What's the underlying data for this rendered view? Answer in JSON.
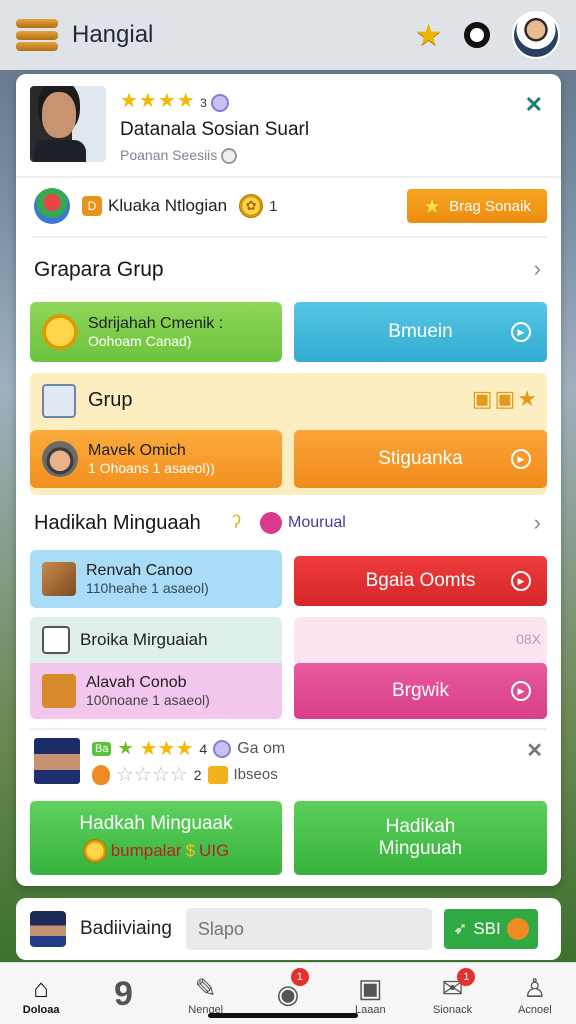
{
  "topbar": {
    "title": "Hangial"
  },
  "profile": {
    "stars": "★★★★",
    "star_count": "3",
    "name": "Datanala Sosian Suarl",
    "subtitle": "Poanan Seesiis"
  },
  "level": {
    "badge": "D",
    "label": "Kluaka Ntlogian",
    "coin_label": "1",
    "coin_icon": "✿",
    "button": "Brag Sonaik"
  },
  "section1": {
    "title": "Grapara Grup"
  },
  "tile_green": {
    "title": "Sdrijahah Cmenik :",
    "subtitle": "Oohoam Canad)"
  },
  "btn_blue": {
    "label": "Bmuein"
  },
  "group": {
    "title": "Grup"
  },
  "tile_orange": {
    "title": "Mavek Omich",
    "subtitle": "1 Ohoans 1 asaeol))"
  },
  "btn_orange": {
    "label": "Stiguanka"
  },
  "section2": {
    "title": "Hadikah Minguaah",
    "tag": "Mourual"
  },
  "tile_blue": {
    "title": "Renvah Canoo",
    "subtitle": "110heahe 1 asaeol)"
  },
  "btn_red": {
    "label": "Bgaia Oomts"
  },
  "tile_lightgreen": {
    "title": "Broika Mirguaiah"
  },
  "pink_label": {
    "text": "08X"
  },
  "tile_pink": {
    "title": "Alavah Conob",
    "subtitle": "100noane 1 asaeol)"
  },
  "btn_pink": {
    "label": "Brgwik"
  },
  "rating": {
    "new_tag": "Ba",
    "stars_top": "★★★",
    "count_top": "4",
    "label_top": "Ga om",
    "stars_bottom": "☆☆☆☆",
    "count_bottom": "2",
    "label_bottom": "Ibseos"
  },
  "bottom_left": {
    "title": "Hadkah Minguaak",
    "subtitle": "bumpalar",
    "extra": "UIG"
  },
  "bottom_right": {
    "line1": "Hadikah",
    "line2": "Minguuah"
  },
  "footer_card": {
    "name": "Badiiviaing",
    "placeholder": "Slapo",
    "button": "SBI"
  },
  "tabs": [
    {
      "label": "Doloaa",
      "icon": "home-icon"
    },
    {
      "label": "",
      "icon": "nine-icon"
    },
    {
      "label": "Nengel",
      "icon": "edit-icon"
    },
    {
      "label": "",
      "icon": "chat-icon",
      "badge": "1"
    },
    {
      "label": "Laaan",
      "icon": "image-icon"
    },
    {
      "label": "Sionack",
      "icon": "mail-icon",
      "badge": "1"
    },
    {
      "label": "Acnoel",
      "icon": "person-icon"
    }
  ]
}
